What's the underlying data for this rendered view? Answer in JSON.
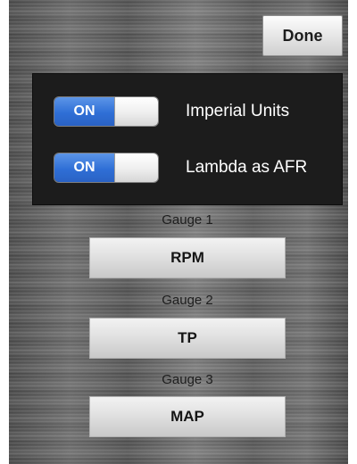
{
  "header": {
    "done_label": "Done"
  },
  "settings": [
    {
      "label": "Imperial Units",
      "state_label": "ON",
      "on": true
    },
    {
      "label": "Lambda as AFR",
      "state_label": "ON",
      "on": true
    }
  ],
  "gauges": [
    {
      "label": "Gauge 1",
      "value": "RPM"
    },
    {
      "label": "Gauge 2",
      "value": "TP"
    },
    {
      "label": "Gauge 3",
      "value": "MAP"
    }
  ],
  "colors": {
    "toggle_on": "#2f6fd6",
    "panel_background": "#1c1c1c"
  }
}
